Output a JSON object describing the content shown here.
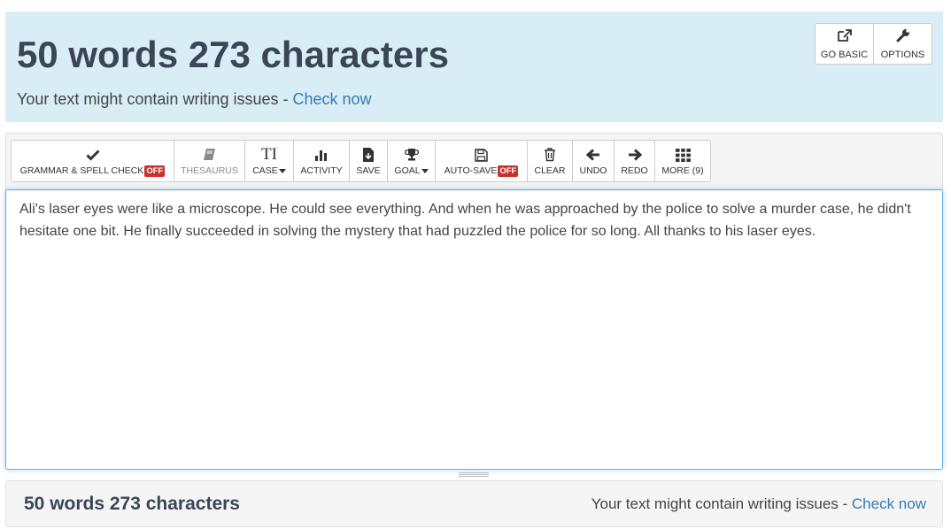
{
  "header": {
    "title": "50 words 273 characters",
    "issues_text": "Your text might contain writing issues - ",
    "issues_link": "Check now",
    "go_basic_label": "GO BASIC",
    "options_label": "OPTIONS"
  },
  "toolbar": {
    "grammar_label": "GRAMMAR & SPELL CHECK",
    "grammar_badge": "OFF",
    "thesaurus_label": "THESAURUS",
    "case_icon_text": "TI",
    "case_label": "CASE",
    "activity_label": "ACTIVITY",
    "save_label": "SAVE",
    "goal_label": "GOAL",
    "autosave_label": "AUTO-SAVE",
    "autosave_badge": "OFF",
    "clear_label": "CLEAR",
    "undo_label": "UNDO",
    "redo_label": "REDO",
    "more_label": "MORE (9)"
  },
  "editor": {
    "text": "Ali's laser eyes were like a microscope. He could see everything. And when he was approached by the police to solve a murder case, he didn't hesitate one bit. He finally succeeded in solving the mystery that had puzzled the police for so long. All thanks to his laser eyes."
  },
  "footer": {
    "count": "50 words 273 characters",
    "issues_text": "Your text might contain writing issues - ",
    "issues_link": "Check now"
  },
  "icons": {
    "grammar": "check-icon",
    "thesaurus": "book-icon",
    "case": "text-case-icon",
    "activity": "bar-chart-icon",
    "save": "file-download-icon",
    "goal": "trophy-icon",
    "autosave": "floppy-icon",
    "clear": "trash-icon",
    "undo": "arrow-left-icon",
    "redo": "arrow-right-icon",
    "more": "grid-icon",
    "go_basic": "external-link-icon",
    "options": "wrench-icon"
  }
}
